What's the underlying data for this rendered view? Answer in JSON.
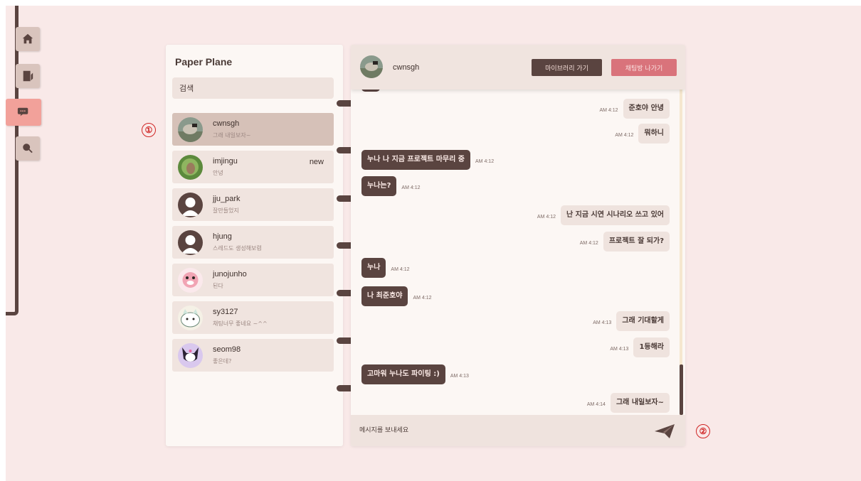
{
  "app": {
    "title": "Paper Plane"
  },
  "search": {
    "placeholder": "검색"
  },
  "nav": [
    "home-icon",
    "feed-icon",
    "chat-icon",
    "search-icon"
  ],
  "chats": [
    {
      "name": "cwnsgh",
      "preview": "그래 내일보자~",
      "new": ""
    },
    {
      "name": "imjingu",
      "preview": "안녕",
      "new": "new"
    },
    {
      "name": "jju_park",
      "preview": "잘만들었지",
      "new": ""
    },
    {
      "name": "hjung",
      "preview": "스레드도 생성해보렴",
      "new": ""
    },
    {
      "name": "junojunho",
      "preview": "된다",
      "new": ""
    },
    {
      "name": "sy3127",
      "preview": "채팅너무 좋네요 ~^^",
      "new": ""
    },
    {
      "name": "seom98",
      "preview": "좋은데?",
      "new": ""
    }
  ],
  "header": {
    "name": "cwnsgh",
    "library_button": "마이브러리 가기",
    "leave_button": "채팅방 나가기"
  },
  "messages": [
    {
      "side": "out",
      "text": "준호야 안녕",
      "time": "AM 4:12"
    },
    {
      "side": "out",
      "text": "뭐하니",
      "time": "AM 4:12"
    },
    {
      "side": "in",
      "text": "누나 나 지금 프로젝트 마무리 중",
      "time": "AM 4:12"
    },
    {
      "side": "in",
      "text": "누나는?",
      "time": "AM 4:12"
    },
    {
      "side": "out",
      "text": "난 지금 시연 시나리오 쓰고 있어",
      "time": "AM 4:12"
    },
    {
      "side": "out",
      "text": "프로젝트 잘 되가?",
      "time": "AM 4:12"
    },
    {
      "side": "in",
      "text": "누나",
      "time": "AM 4:12"
    },
    {
      "side": "in",
      "text": "나 최준호야",
      "time": "AM 4:12"
    },
    {
      "side": "out",
      "text": "그래 기대할게",
      "time": "AM 4:13"
    },
    {
      "side": "out",
      "text": "1등해라",
      "time": "AM 4:13"
    },
    {
      "side": "in",
      "text": "고마워 누나도 파이팅 :)",
      "time": "AM 4:13"
    },
    {
      "side": "out",
      "text": "그래 내일보자~",
      "time": "AM 4:14"
    }
  ],
  "composer": {
    "placeholder": "메시지를 보내세요"
  },
  "markers": [
    "①",
    "②"
  ],
  "colors": {
    "accent": "#5a4440",
    "active_nav": "#f2a19a",
    "leave": "#d9737b",
    "background": "#f9e9e8"
  }
}
